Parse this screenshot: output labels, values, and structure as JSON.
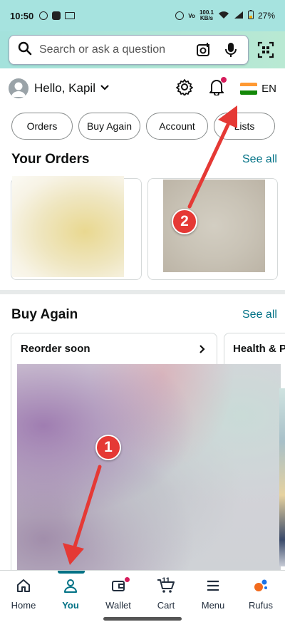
{
  "status_bar": {
    "time": "10:50",
    "battery": "27%",
    "net_speed_value": "100.1",
    "net_speed_unit": "KB/s"
  },
  "search": {
    "placeholder": "Search or ask a question"
  },
  "header": {
    "greeting": "Hello, Kapil",
    "language": "EN"
  },
  "chips": [
    "Orders",
    "Buy Again",
    "Account",
    "Lists"
  ],
  "your_orders": {
    "title": "Your Orders",
    "see_all": "See all"
  },
  "buy_again": {
    "title": "Buy Again",
    "see_all": "See all",
    "cards": [
      "Reorder soon",
      "Health & P"
    ]
  },
  "annotations": [
    "1",
    "2"
  ],
  "annotation_color": "#e53935",
  "accent_color": "#007185",
  "bottom_nav": {
    "items": [
      {
        "label": "Home",
        "icon": "home-icon"
      },
      {
        "label": "You",
        "icon": "person-icon",
        "active": true
      },
      {
        "label": "Wallet",
        "icon": "wallet-icon"
      },
      {
        "label": "Cart",
        "icon": "cart-icon",
        "count": "11"
      },
      {
        "label": "Menu",
        "icon": "menu-icon"
      },
      {
        "label": "Rufus",
        "icon": "rufus-icon"
      }
    ]
  }
}
